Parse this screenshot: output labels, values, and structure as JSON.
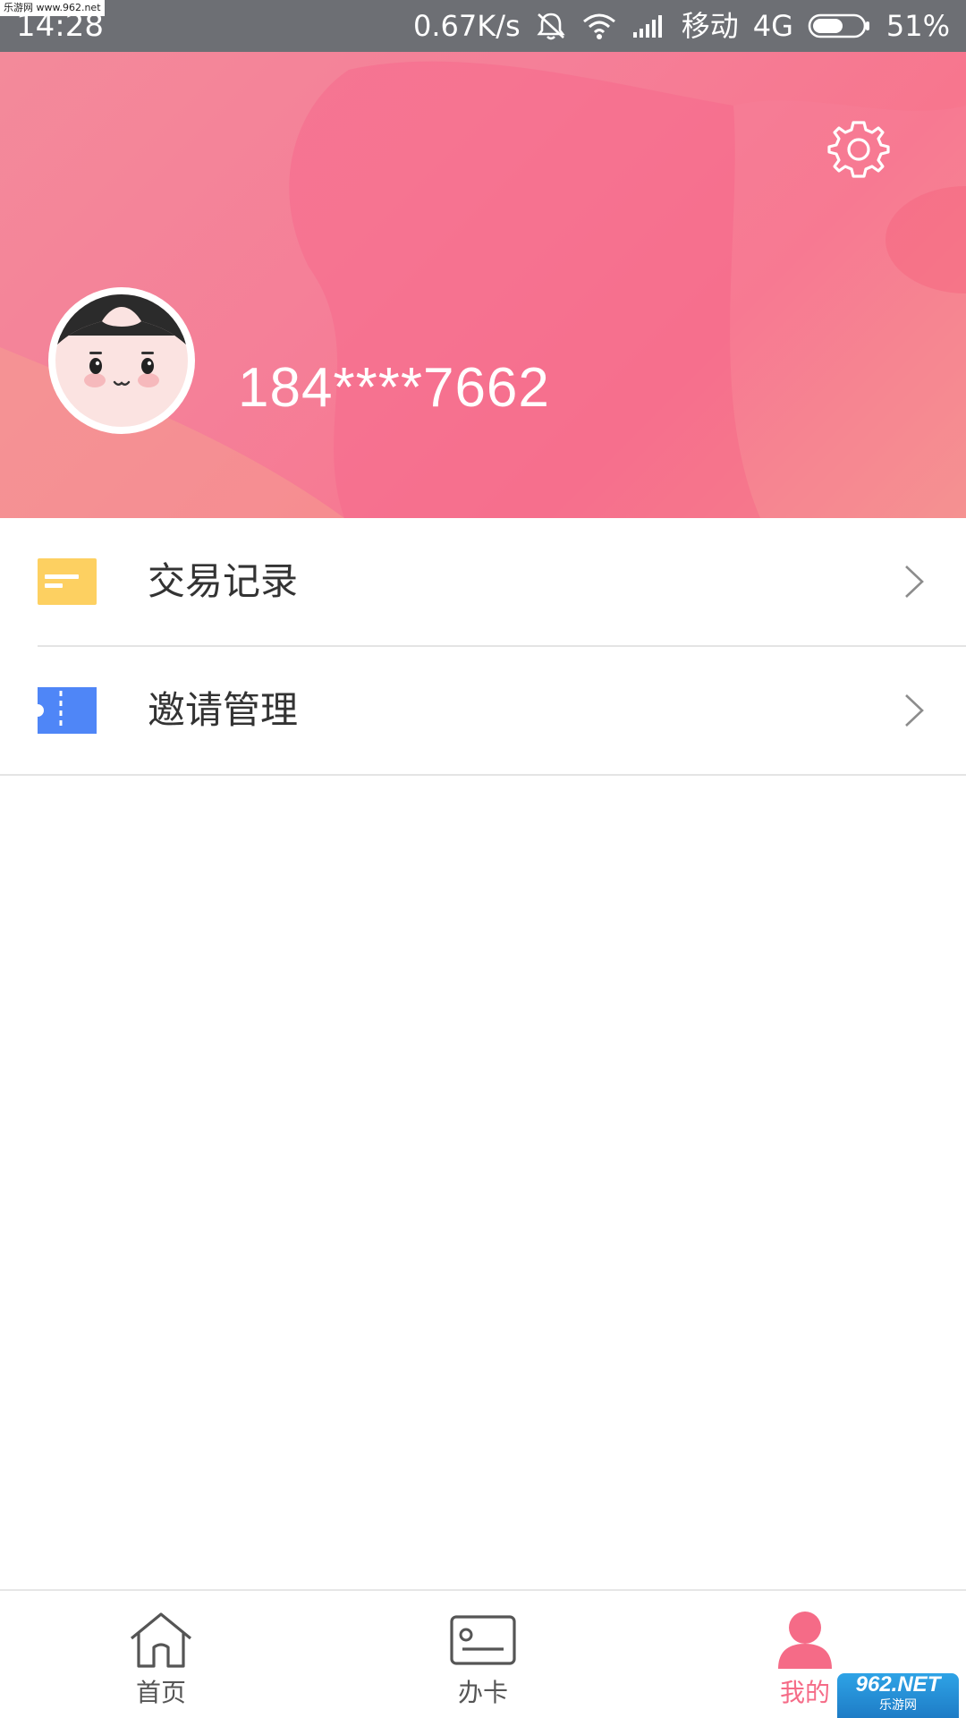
{
  "status_bar": {
    "watermark": "乐游网 www.962.net",
    "time": "14:28",
    "net_speed": "0.67K/s",
    "carrier": "移动",
    "network_type": "4G",
    "battery_percent": "51%",
    "icons": [
      "alarm-off-icon",
      "wifi-icon",
      "signal-icon",
      "battery-icon"
    ]
  },
  "header": {
    "username": "184****7662",
    "settings_icon": "gear-icon",
    "colors": {
      "gradient_start": "#f38a9a",
      "gradient_end": "#f7768e"
    }
  },
  "menu": {
    "items": [
      {
        "label": "交易记录",
        "icon": "transaction-record-icon",
        "icon_color": "#fdd061"
      },
      {
        "label": "邀请管理",
        "icon": "ticket-icon",
        "icon_color": "#4f86f7"
      }
    ]
  },
  "bottom_nav": {
    "items": [
      {
        "label": "首页",
        "icon": "home-icon",
        "active": false
      },
      {
        "label": "办卡",
        "icon": "card-icon",
        "active": false
      },
      {
        "label": "我的",
        "icon": "user-icon",
        "active": true
      }
    ],
    "active_color": "#f56b87"
  },
  "watermark_br": {
    "top": "962.NET",
    "bottom": "乐游网"
  }
}
